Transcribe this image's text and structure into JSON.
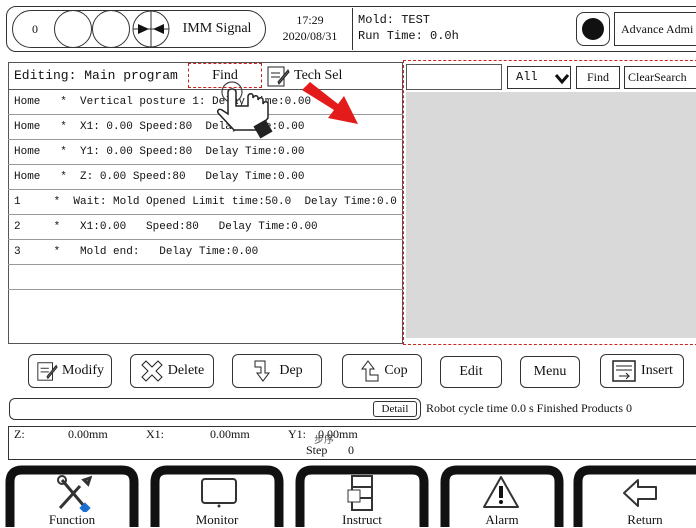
{
  "header": {
    "counter": "0",
    "imm_label": "IMM Signal",
    "time": "17:29",
    "date": "2020/08/31",
    "mold_line": "Mold: TEST",
    "runtime_line": "Run Time: 0.0h",
    "user_label": "Advance Admi"
  },
  "editor": {
    "editing_label": "Editing: Main program",
    "find_label": "Find",
    "techsel_label": "Tech Sel",
    "rows": [
      "Home   *  Vertical posture 1: Delay Time:0.00",
      "Home   *  X1: 0.00 Speed:80  Delay Time:0.00",
      "Home   *  Y1: 0.00 Speed:80  Delay Time:0.00",
      "Home   *  Z: 0.00 Speed:80   Delay Time:0.00",
      "1     *  Wait: Mold Opened Limit time:50.0  Delay Time:0.0",
      "2     *   X1:0.00   Speed:80   Delay Time:0.00",
      "3     *   Mold end:   Delay Time:0.00",
      "",
      ""
    ]
  },
  "search": {
    "input_value": "",
    "filter_selected": "All",
    "find_label": "Find",
    "clear_label": "ClearSearch"
  },
  "toolbar": {
    "modify": "Modify",
    "delete": "Delete",
    "dep": "Dep",
    "cop": "Cop",
    "edit": "Edit",
    "menu": "Menu",
    "insert": "Insert"
  },
  "status": {
    "detail": "Detail",
    "cycle_text": "Robot cycle time 0.0 s Finished Products  0"
  },
  "position": {
    "z_label": "Z:",
    "z_value": "0.00mm",
    "x1_label": "X1:",
    "x1_value": "0.00mm",
    "y1_label": "Y1:",
    "y1_value": "0.00mm",
    "step_cn": "步序",
    "step_label": "Step",
    "step_value": "0"
  },
  "tabs": [
    "Function",
    "Monitor",
    "Instruct",
    "Alarm",
    "Return"
  ],
  "colors": {
    "accent": "#e31b1b",
    "panel": "#d9d9d9",
    "border": "#333333"
  }
}
